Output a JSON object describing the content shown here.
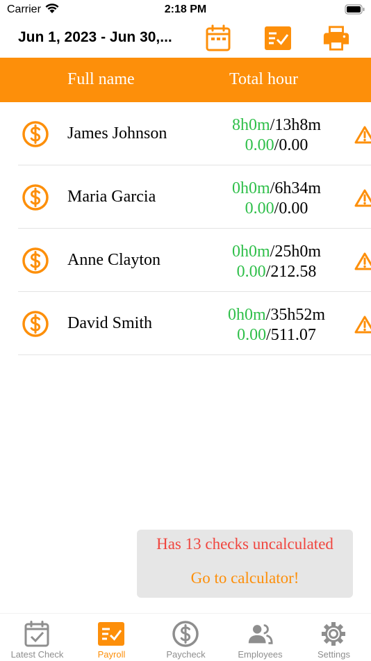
{
  "status_bar": {
    "carrier": "Carrier",
    "time": "2:18 PM"
  },
  "top_bar": {
    "date_range": "Jun 1, 2023 -  Jun 30,..."
  },
  "table": {
    "col_name": "Full name",
    "col_hours": "Total hour",
    "rows": [
      {
        "name": "James Johnson",
        "hours_worked": "8h0m",
        "hours_total": "13h8m",
        "pay_done": "0.00",
        "pay_total": "0.00"
      },
      {
        "name": "Maria Garcia",
        "hours_worked": "0h0m",
        "hours_total": "6h34m",
        "pay_done": "0.00",
        "pay_total": "0.00"
      },
      {
        "name": "Anne Clayton",
        "hours_worked": "0h0m",
        "hours_total": "25h0m",
        "pay_done": "0.00",
        "pay_total": "212.58"
      },
      {
        "name": "David Smith",
        "hours_worked": "0h0m",
        "hours_total": "35h52m",
        "pay_done": "0.00",
        "pay_total": "511.07"
      }
    ]
  },
  "notice": {
    "message": "Has 13 checks uncalculated",
    "link": "Go to calculator!"
  },
  "tabs": [
    {
      "label": "Latest Check",
      "icon": "calendar-check-icon"
    },
    {
      "label": "Payroll",
      "icon": "payroll-icon",
      "active": true
    },
    {
      "label": "Paycheck",
      "icon": "dollar-circle-icon"
    },
    {
      "label": "Employees",
      "icon": "people-icon"
    },
    {
      "label": "Settings",
      "icon": "gear-icon"
    }
  ],
  "colors": {
    "accent": "#fd8f0a",
    "green": "#2fbf4a",
    "red": "#f0453e",
    "inactive": "#8e8e8e"
  }
}
